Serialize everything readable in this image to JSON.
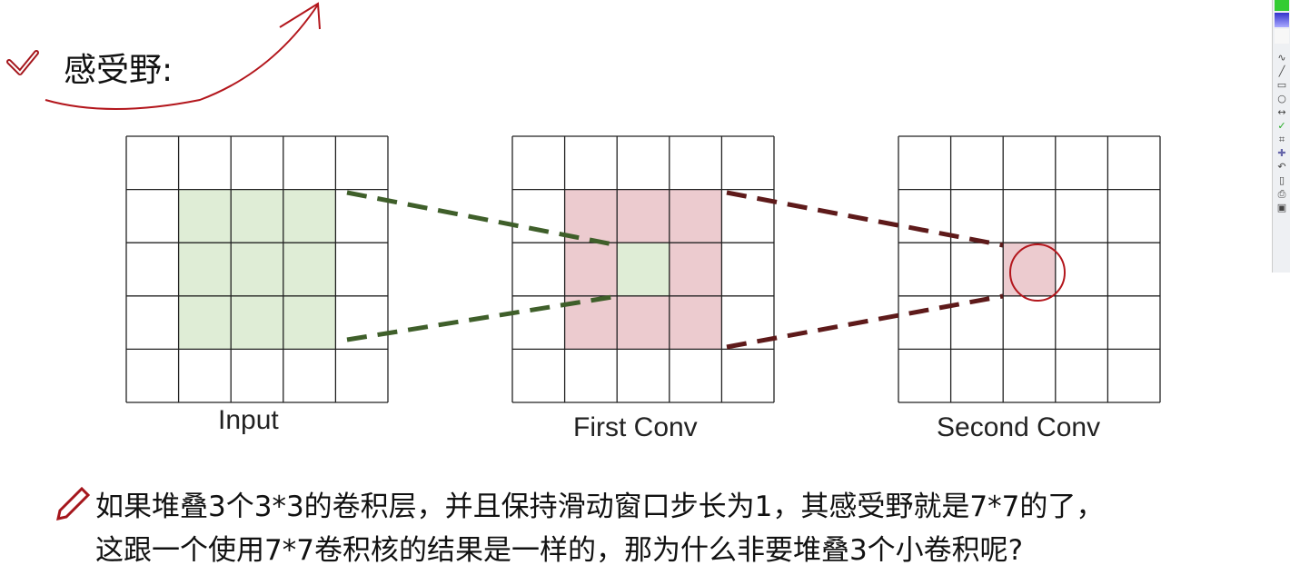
{
  "heading": "感受野:",
  "diagram": {
    "labels": [
      "Input",
      "First Conv",
      "Second Conv"
    ],
    "grid_size": 5,
    "colors": {
      "green": "#dfedd6",
      "pink": "#eccbcf",
      "green_line": "#3f5f2a",
      "red_line": "#5e1a1a",
      "annotation": "#b3161c"
    }
  },
  "paragraph": {
    "line1": "如果堆叠3个3*3的卷积层，并且保持滑动窗口步长为1，其感受野就是7*7的了，",
    "line2": "这跟一个使用7*7卷积核的结果是一样的，那为什么非要堆叠3个小卷积呢?"
  },
  "toolbar": [
    "pen-icon",
    "line-icon",
    "rectangle-icon",
    "ellipse-icon",
    "arrow-icon",
    "check-icon",
    "crop-icon",
    "add-icon",
    "undo-icon",
    "new-page-icon",
    "print-icon",
    "image-icon"
  ]
}
